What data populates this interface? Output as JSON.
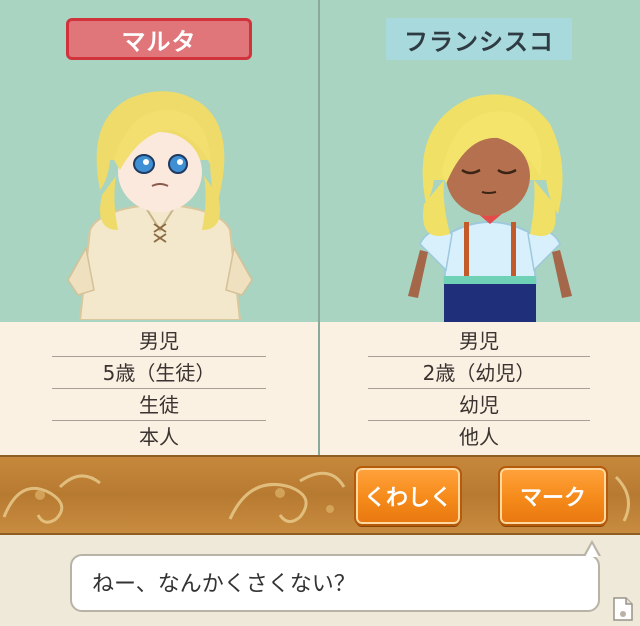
{
  "left_character": {
    "name": "マルタ",
    "info": [
      "男児",
      "5歳（生徒）",
      "生徒",
      "本人"
    ]
  },
  "right_character": {
    "name": "フランシスコ",
    "info": [
      "男児",
      "2歳（幼児）",
      "幼児",
      "他人"
    ]
  },
  "buttons": {
    "details": "くわしく",
    "mark": "マーク"
  },
  "dialog": {
    "text": "ねー、なんかくさくない？"
  },
  "colors": {
    "panel_bg": "#a9d4c1",
    "left_tag": "#e0757a",
    "right_tag": "#a8dadd",
    "button": "#f58a1a"
  },
  "icons": [
    "scroll-ornament-icon",
    "page-corner-icon"
  ]
}
